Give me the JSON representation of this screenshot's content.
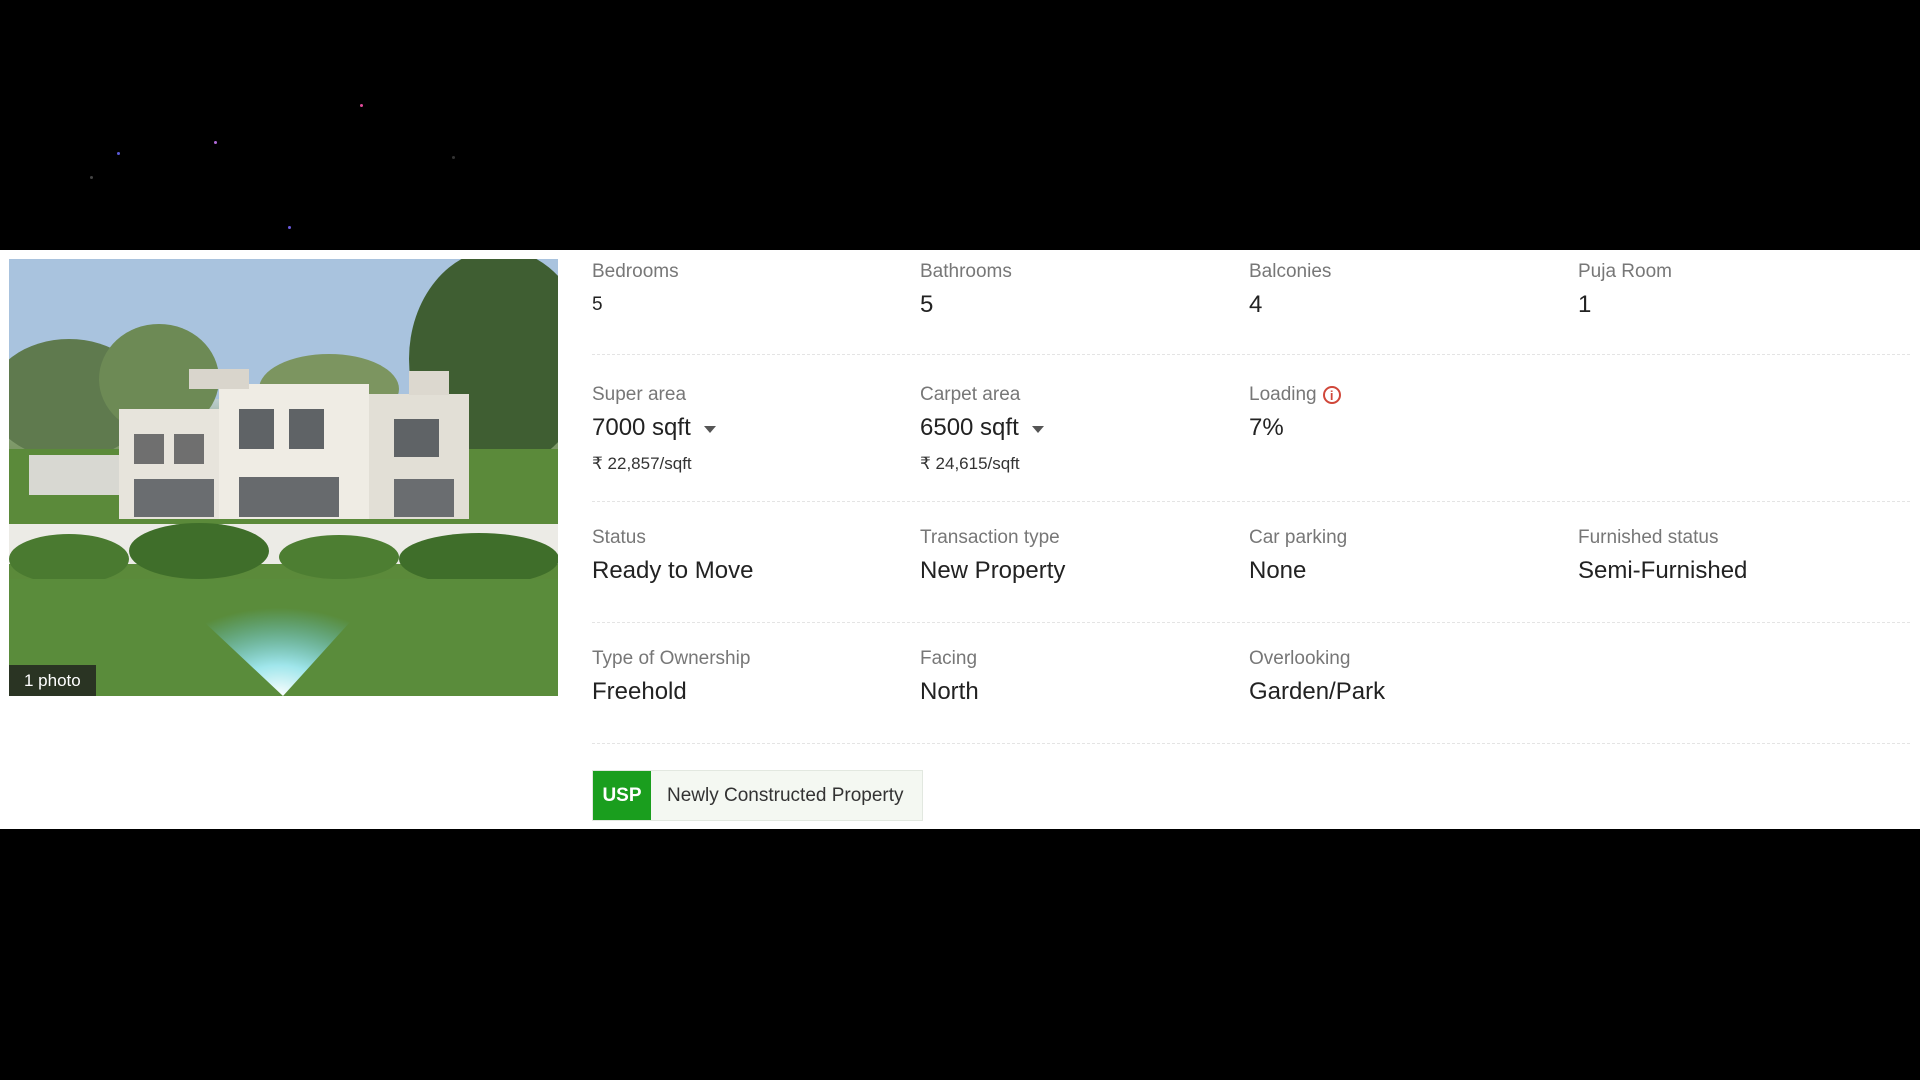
{
  "photo": {
    "count_label": "1 photo"
  },
  "rows": [
    [
      {
        "label": "Bedrooms",
        "value": "5",
        "small": true
      },
      {
        "label": "Bathrooms",
        "value": "5"
      },
      {
        "label": "Balconies",
        "value": "4"
      },
      {
        "label": "Puja Room",
        "value": "1"
      }
    ],
    [
      {
        "label": "Super area",
        "value": "7000 sqft",
        "dropdown": true,
        "sub": "₹ 22,857/sqft"
      },
      {
        "label": "Carpet area",
        "value": "6500 sqft",
        "dropdown": true,
        "sub": "₹ 24,615/sqft"
      },
      {
        "label": "Loading",
        "value": "7%",
        "info": true
      }
    ],
    [
      {
        "label": "Status",
        "value": "Ready to Move"
      },
      {
        "label": "Transaction type",
        "value": "New Property"
      },
      {
        "label": "Car parking",
        "value": "None"
      },
      {
        "label": "Furnished status",
        "value": "Semi-Furnished"
      }
    ],
    [
      {
        "label": "Type of Ownership",
        "value": "Freehold"
      },
      {
        "label": "Facing",
        "value": "North"
      },
      {
        "label": "Overlooking",
        "value": "Garden/Park"
      }
    ]
  ],
  "usp": {
    "badge": "USP",
    "text": "Newly Constructed Property"
  },
  "icons": {
    "info": "info-icon",
    "dropdown": "caret-down-icon"
  },
  "colors": {
    "usp_green": "#1a9e1e",
    "info_red": "#d0473a"
  }
}
